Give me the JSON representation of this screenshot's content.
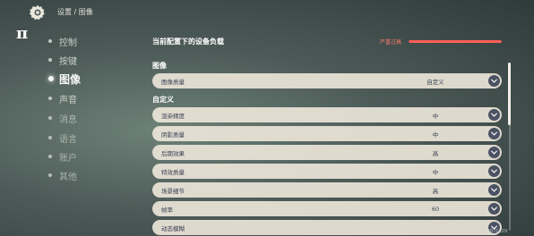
{
  "header": {
    "breadcrumb": "设置 / 图像",
    "logo_text": "π"
  },
  "sidebar": {
    "items": [
      {
        "label": "控制"
      },
      {
        "label": "按键"
      },
      {
        "label": "图像"
      },
      {
        "label": "声音"
      },
      {
        "label": "消息"
      },
      {
        "label": "语言"
      },
      {
        "label": "账户"
      },
      {
        "label": "其他"
      }
    ],
    "active": "图像"
  },
  "device_load": {
    "title": "当前配置下的设备负载",
    "status": "严重过高",
    "status_color": "#ff5f57",
    "level": 1.0
  },
  "sections": {
    "graphics": "图像",
    "custom": "自定义"
  },
  "graphics_rows": [
    {
      "label": "图像质量",
      "value": "自定义"
    }
  ],
  "custom_rows": [
    {
      "label": "渲染精度",
      "value": "中"
    },
    {
      "label": "阴影质量",
      "value": "中"
    },
    {
      "label": "后期效果",
      "value": "高"
    },
    {
      "label": "特效质量",
      "value": "中"
    },
    {
      "label": "场景细节",
      "value": "高"
    },
    {
      "label": "帧率",
      "value": "60"
    },
    {
      "label": "动态模糊",
      "value": ""
    }
  ],
  "footer": {
    "uid": "UID: 193871229"
  },
  "icons": {
    "gear": "gear-icon",
    "dropdown": "chevron-down-icon"
  }
}
